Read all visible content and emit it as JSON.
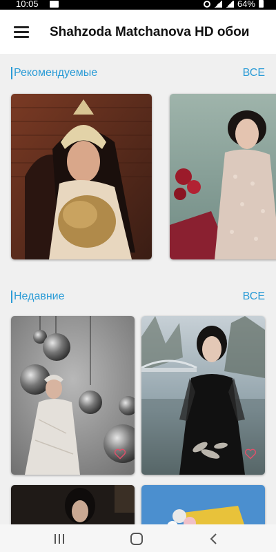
{
  "status_bar": {
    "time": "10:05",
    "battery": "64%"
  },
  "app_bar": {
    "title": "Shahzoda Matchanova HD обои"
  },
  "sections": [
    {
      "title": "Рекомендуемые",
      "all_label": "ВСЕ"
    },
    {
      "title": "Недавние",
      "all_label": "ВСЕ"
    }
  ],
  "colors": {
    "accent": "#2a9bd6",
    "heart": "#e0506a"
  },
  "icons": [
    "menu-icon",
    "heart-icon",
    "recents-icon",
    "home-icon",
    "back-icon"
  ]
}
